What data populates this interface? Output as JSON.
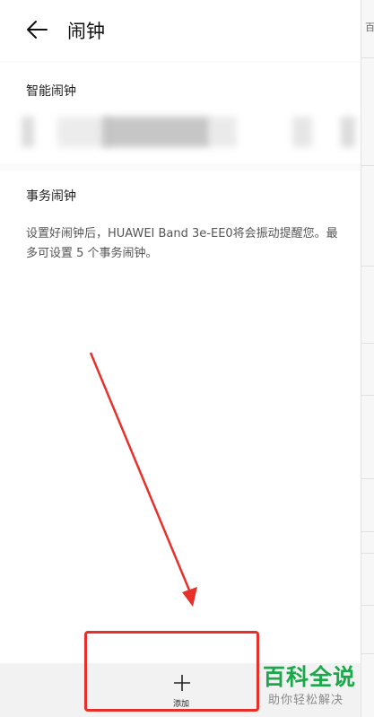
{
  "header": {
    "title": "闹钟",
    "back_icon": "back-arrow-icon"
  },
  "smart_alarm": {
    "section_title": "智能闹钟"
  },
  "event_alarm": {
    "section_title": "事务闹钟",
    "description": "设置好闹钟后，HUAWEI Band 3e-EE0将会振动提醒您。最多可设置 5 个事务闹钟。"
  },
  "bottom_bar": {
    "add_label": "添加",
    "add_icon": "plus-icon"
  },
  "annotation": {
    "color": "#e8302b"
  },
  "watermark": {
    "main": "百科全说",
    "sub": "助你轻松解决",
    "color": "#1aa84a"
  },
  "right_sliver": {
    "glyph": "百"
  }
}
